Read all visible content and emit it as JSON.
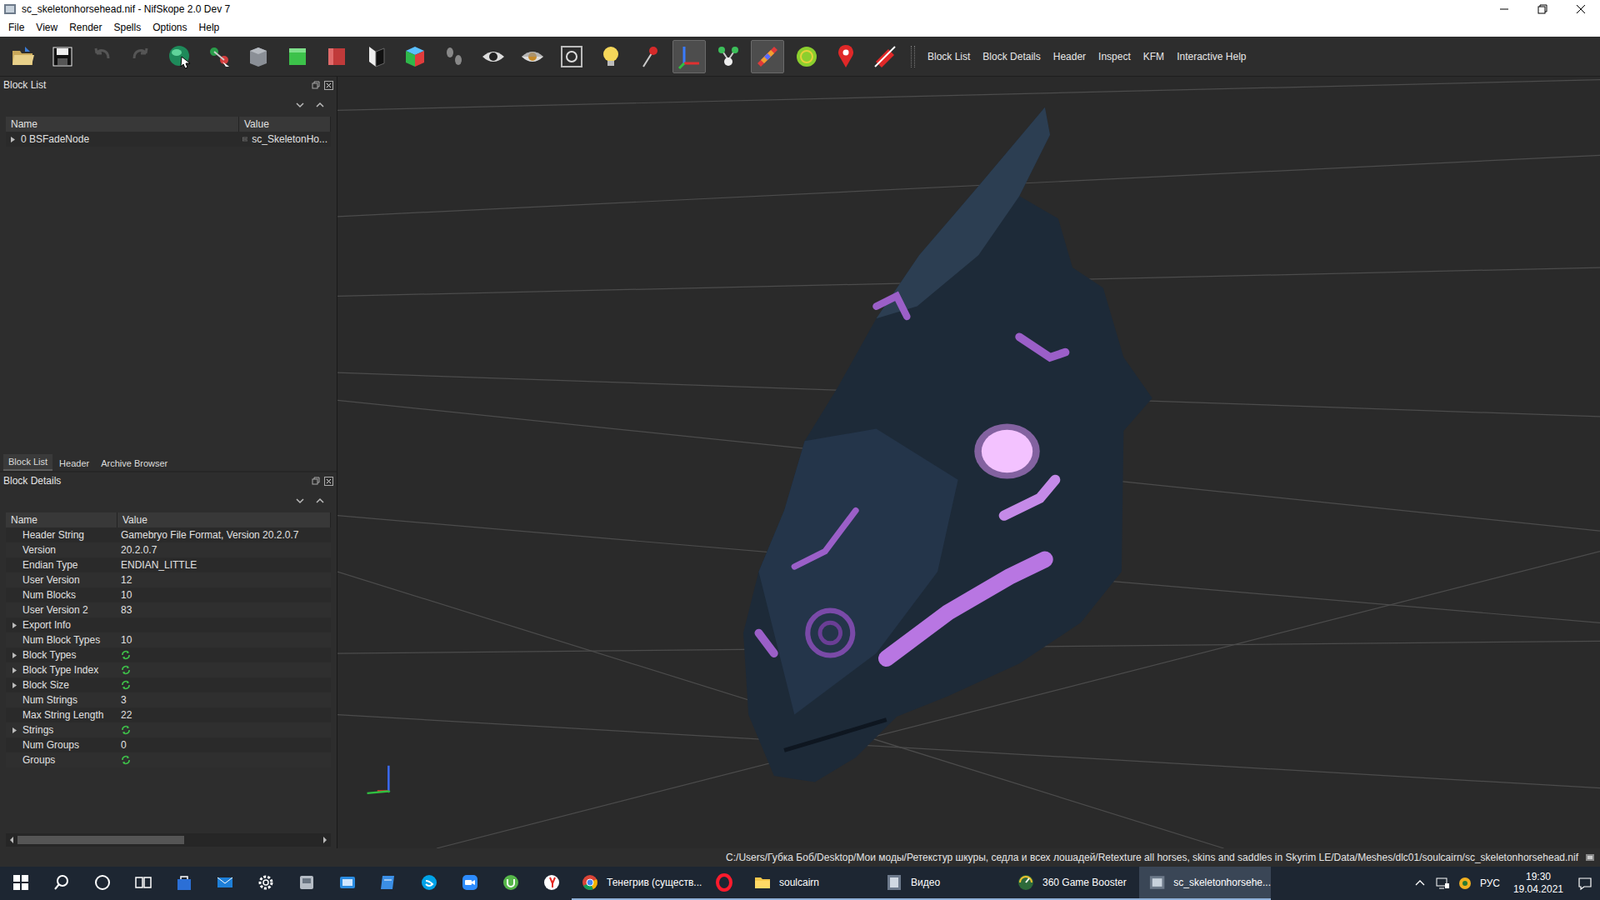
{
  "window": {
    "title": "sc_skeletonhorsehead.nif - NifSkope 2.0 Dev 7"
  },
  "menu": [
    "File",
    "View",
    "Render",
    "Spells",
    "Options",
    "Help"
  ],
  "toolbar": {
    "buttons": [
      {
        "kind": "open",
        "pressed": false
      },
      {
        "kind": "save",
        "pressed": false
      },
      {
        "kind": "undo",
        "pressed": false
      },
      {
        "kind": "redo",
        "pressed": false
      },
      {
        "kind": "select",
        "pressed": false
      },
      {
        "kind": "node",
        "pressed": false
      },
      {
        "kind": "cube-grey",
        "pressed": false
      },
      {
        "kind": "cube-green",
        "pressed": false
      },
      {
        "kind": "cube-red",
        "pressed": false
      },
      {
        "kind": "flip",
        "pressed": false
      },
      {
        "kind": "cube-color",
        "pressed": false
      },
      {
        "kind": "footprints",
        "pressed": false
      },
      {
        "kind": "eye",
        "pressed": false
      },
      {
        "kind": "eye-half",
        "pressed": false
      },
      {
        "kind": "camera",
        "pressed": false
      },
      {
        "kind": "light",
        "pressed": false
      },
      {
        "kind": "pin",
        "pressed": false
      },
      {
        "kind": "axes",
        "pressed": true
      },
      {
        "kind": "nodes",
        "pressed": false
      },
      {
        "kind": "gradient",
        "pressed": true
      },
      {
        "kind": "sphere",
        "pressed": false
      },
      {
        "kind": "marker",
        "pressed": false
      },
      {
        "kind": "eraser",
        "pressed": false
      }
    ],
    "links": [
      "Block List",
      "Block Details",
      "Header",
      "Inspect",
      "KFM",
      "Interactive Help"
    ]
  },
  "block_list": {
    "title": "Block List",
    "columns": [
      "Name",
      "Value"
    ],
    "rows": [
      {
        "name": "0 BSFadeNode",
        "value": "sc_SkeletonHo...",
        "expanded": false
      }
    ],
    "tabs": [
      {
        "label": "Block List",
        "selected": true
      },
      {
        "label": "Header",
        "selected": false
      },
      {
        "label": "Archive Browser",
        "selected": false
      }
    ]
  },
  "block_details": {
    "title": "Block Details",
    "columns": [
      "Name",
      "Value"
    ],
    "rows": [
      {
        "name": "Header String",
        "value": "Gamebryo File Format, Version 20.2.0.7",
        "kind": "text",
        "expandable": false
      },
      {
        "name": "Version",
        "value": "20.2.0.7",
        "kind": "text",
        "expandable": false
      },
      {
        "name": "Endian Type",
        "value": "ENDIAN_LITTLE",
        "kind": "text",
        "expandable": false
      },
      {
        "name": "User Version",
        "value": "12",
        "kind": "text",
        "expandable": false
      },
      {
        "name": "Num Blocks",
        "value": "10",
        "kind": "text",
        "expandable": false
      },
      {
        "name": "User Version 2",
        "value": "83",
        "kind": "text",
        "expandable": false
      },
      {
        "name": "Export Info",
        "value": "",
        "kind": "empty",
        "expandable": true
      },
      {
        "name": "Num Block Types",
        "value": "10",
        "kind": "text",
        "expandable": false
      },
      {
        "name": "Block Types",
        "value": "",
        "kind": "icon",
        "expandable": true
      },
      {
        "name": "Block Type Index",
        "value": "",
        "kind": "icon",
        "expandable": true
      },
      {
        "name": "Block Size",
        "value": "",
        "kind": "icon",
        "expandable": true
      },
      {
        "name": "Num Strings",
        "value": "3",
        "kind": "text",
        "expandable": false
      },
      {
        "name": "Max String Length",
        "value": "22",
        "kind": "text",
        "expandable": false
      },
      {
        "name": "Strings",
        "value": "",
        "kind": "icon",
        "expandable": true
      },
      {
        "name": "Num Groups",
        "value": "0",
        "kind": "text",
        "expandable": false
      },
      {
        "name": "Groups",
        "value": "",
        "kind": "icon",
        "expandable": false
      }
    ]
  },
  "status_bar": {
    "path": "C:/Users/Губка Боб/Desktop/Мои моды/Ретекстур шкуры, седла и всех лошадей/Retexture all horses, skins and saddles in Skyrim LE/Data/Meshes/dlc01/soulcairn/sc_skeletonhorsehead.nif"
  },
  "taskbar": {
    "apps": [
      {
        "kind": "start",
        "label": "",
        "running": false,
        "active": false
      },
      {
        "kind": "search",
        "label": "",
        "running": false,
        "active": false
      },
      {
        "kind": "cortana",
        "label": "",
        "running": false,
        "active": false
      },
      {
        "kind": "taskview",
        "label": "",
        "running": false,
        "active": false
      },
      {
        "kind": "store",
        "label": "",
        "running": false,
        "active": false
      },
      {
        "kind": "mail",
        "label": "",
        "running": false,
        "active": false
      },
      {
        "kind": "settings",
        "label": "",
        "running": false,
        "active": false
      },
      {
        "kind": "app-grey",
        "label": "",
        "running": false,
        "active": false
      },
      {
        "kind": "app-blue",
        "label": "",
        "running": false,
        "active": false
      },
      {
        "kind": "app-note",
        "label": "",
        "running": false,
        "active": false
      },
      {
        "kind": "skype",
        "label": "",
        "running": false,
        "active": false
      },
      {
        "kind": "zoom",
        "label": "",
        "running": false,
        "active": false
      },
      {
        "kind": "utorrent",
        "label": "",
        "running": false,
        "active": false
      },
      {
        "kind": "yandex",
        "label": "",
        "running": false,
        "active": false
      },
      {
        "kind": "chrome",
        "label": "Тенегрив (существ...",
        "running": true,
        "active": false
      },
      {
        "kind": "opera",
        "label": "",
        "running": true,
        "active": false
      },
      {
        "kind": "folder",
        "label": "soulcairn",
        "running": true,
        "active": false
      },
      {
        "kind": "video",
        "label": "Видео",
        "running": true,
        "active": false
      },
      {
        "kind": "booster",
        "label": "360 Game Booster",
        "running": true,
        "active": false
      },
      {
        "kind": "nifskope",
        "label": "sc_skeletonhorsehe...",
        "running": true,
        "active": true
      }
    ],
    "tray": {
      "language": "РУС",
      "time": "19:30",
      "date": "19.04.2021"
    }
  }
}
